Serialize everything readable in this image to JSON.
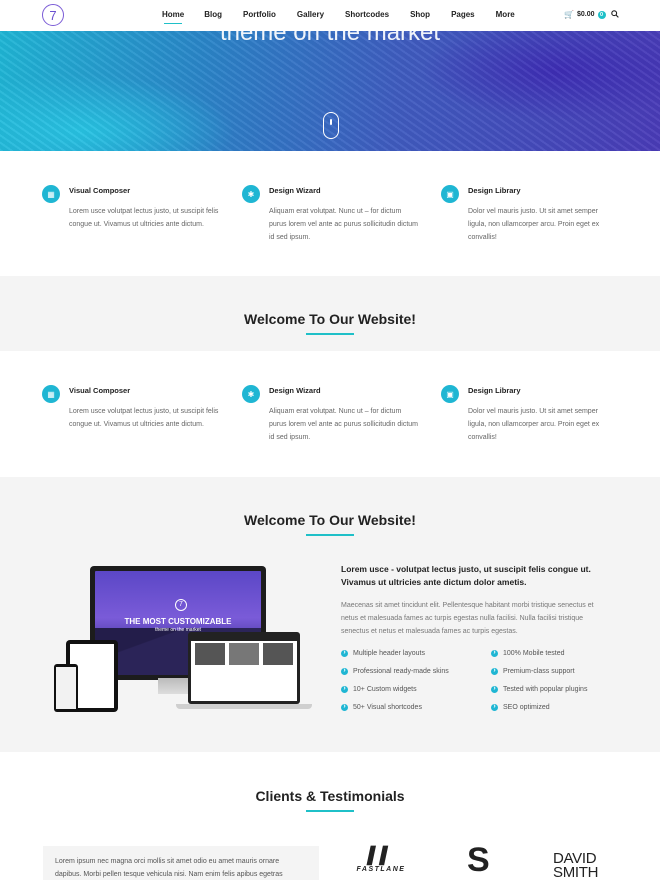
{
  "header": {
    "logo": "7",
    "nav": [
      "Home",
      "Blog",
      "Portfolio",
      "Gallery",
      "Shortcodes",
      "Shop",
      "Pages",
      "More"
    ],
    "active_nav": "Home",
    "cart_total": "$0.00",
    "cart_count": "0"
  },
  "hero": {
    "title": "theme on the market"
  },
  "features_1": [
    {
      "icon": "grid-icon",
      "title": "Visual Composer",
      "text": "Lorem usce volutpat lectus justo, ut suscipit felis congue ut. Vivamus ut ultricies ante dictum."
    },
    {
      "icon": "share-icon",
      "title": "Design Wizard",
      "text": "Aliquam erat volutpat. Nunc ut – for dictum purus lorem vel ante ac purus sollicitudin dictum id sed ipsum."
    },
    {
      "icon": "image-icon",
      "title": "Design Library",
      "text": "Dolor vel mauris justo. Ut sit amet semper ligula, non ullamcorper arcu. Proin eget ex convallis!"
    }
  ],
  "welcome_1": {
    "title": "Welcome To Our Website!"
  },
  "features_2": [
    {
      "icon": "grid-icon",
      "title": "Visual Composer",
      "text": "Lorem usce volutpat lectus justo, ut suscipit felis congue ut. Vivamus ut ultricies ante dictum."
    },
    {
      "icon": "share-icon",
      "title": "Design Wizard",
      "text": "Aliquam erat volutpat. Nunc ut – for dictum purus lorem vel ante ac purus sollicitudin dictum id sed ipsum."
    },
    {
      "icon": "image-icon",
      "title": "Design Library",
      "text": "Dolor vel mauris justo. Ut sit amet semper ligula, non ullamcorper arcu. Proin eget ex convallis!"
    }
  ],
  "welcome_2": {
    "title": "Welcome To Our Website!",
    "lead": "Lorem usce - volutpat lectus justo, ut suscipit felis congue ut. Vivamus ut ultricies ante dictum dolor ametis.",
    "paragraph": "Maecenas sit amet tincidunt elit. Pellentesque habitant morbi tristique senectus et netus et malesuada fames ac turpis egestas nulla facilisi. Nulla facilisi tristique senectus et netus et malesuada fames ac turpis egestas.",
    "screen_title": "THE MOST CUSTOMIZABLE",
    "screen_subtitle": "theme on the market",
    "screen_logo": "7",
    "list_left": [
      "Multiple header layouts",
      "Professional ready-made skins",
      "10+ Custom widgets",
      "50+ Visual shortcodes"
    ],
    "list_right": [
      "100% Mobile tested",
      "Premium-class support",
      "Tested with popular plugins",
      "SEO optimized"
    ]
  },
  "testimonials": {
    "title": "Clients & Testimonials",
    "quote": "Lorem ipsum nec magna orci mollis sit amet odio eu amet mauris ornare dapibus. Morbi pellen tesque vehicula nisi. Nam enim felis apibus egetras",
    "clients": [
      "FASTLANE",
      "S",
      "DAVID SMITH"
    ]
  },
  "colors": {
    "accent": "#1fc0c8",
    "icon_bg": "#1fb6d3",
    "band": "#f4f4f4"
  }
}
